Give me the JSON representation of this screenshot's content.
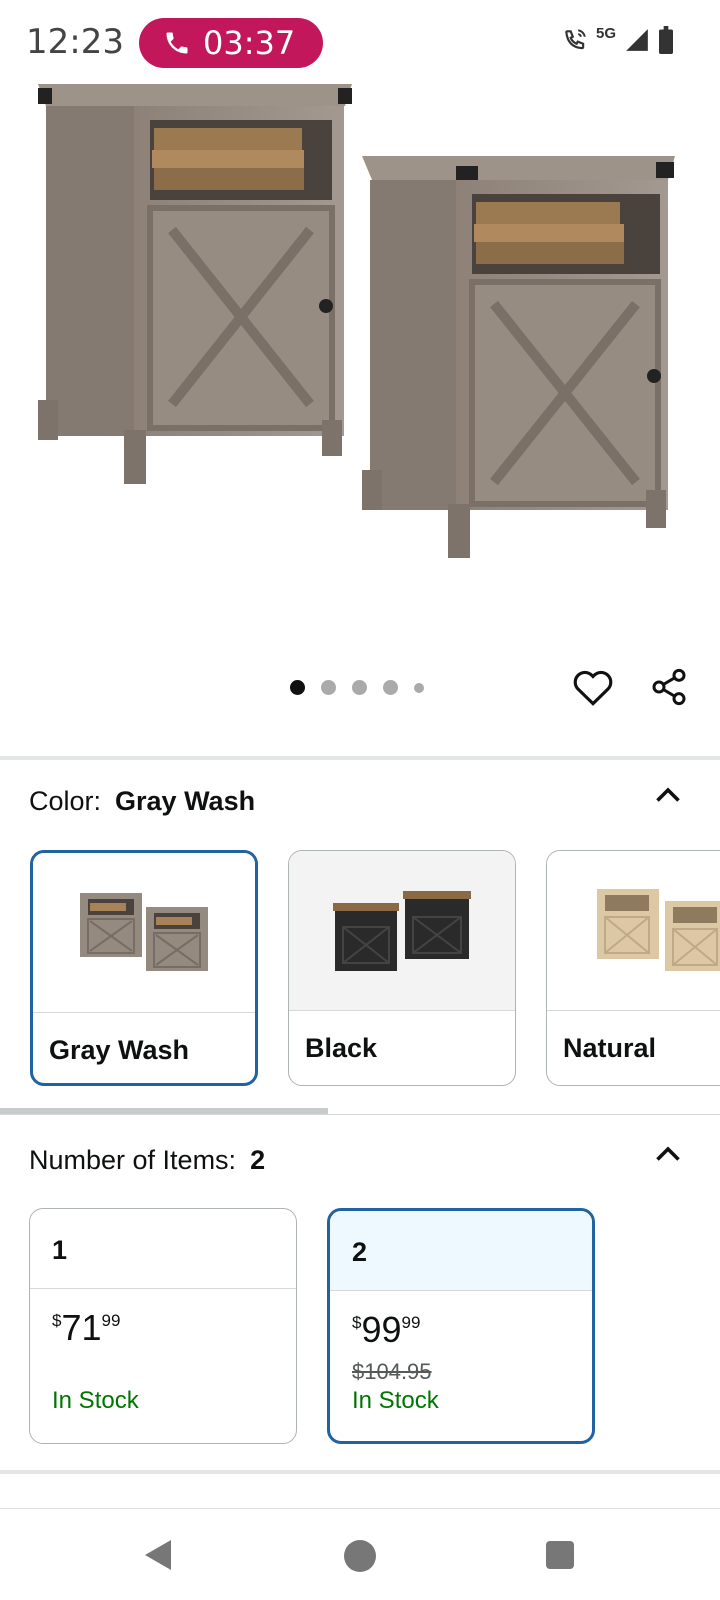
{
  "status_bar": {
    "time": "12:23",
    "call_timer": "03:37",
    "network": "5G",
    "icons": [
      "phone-call-icon",
      "wifi-calling-icon",
      "signal-icon",
      "battery-icon"
    ]
  },
  "gallery": {
    "image_count": 5,
    "active_index": 0,
    "icons": [
      "heart-icon",
      "share-icon"
    ]
  },
  "color": {
    "label": "Color:",
    "selected": "Gray Wash",
    "options": [
      {
        "name": "Gray Wash",
        "selected": true
      },
      {
        "name": "Black",
        "selected": false
      },
      {
        "name": "Natural",
        "selected": false
      }
    ]
  },
  "items": {
    "label": "Number of Items:",
    "selected": "2",
    "options": [
      {
        "qty": "1",
        "currency": "$",
        "whole": "71",
        "cents": "99",
        "list_price": "",
        "stock": "In Stock",
        "selected": false
      },
      {
        "qty": "2",
        "currency": "$",
        "whole": "99",
        "cents": "99",
        "list_price": "$104.95",
        "stock": "In Stock",
        "selected": true
      }
    ]
  },
  "colors": {
    "accent": "#2162a1",
    "call_pill": "#c2185b",
    "stock_green": "#007600",
    "selected_header_bg": "#edf8ff"
  }
}
